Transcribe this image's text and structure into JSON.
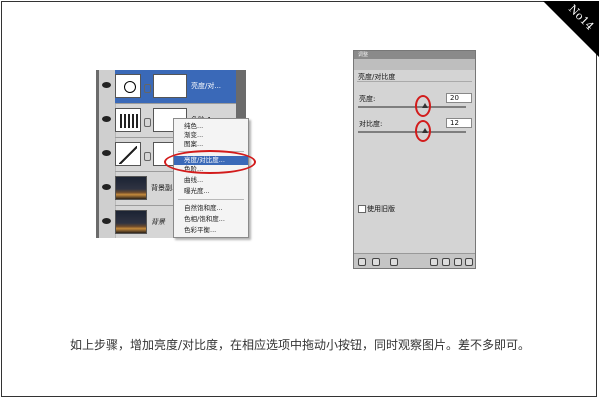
{
  "badge": "No14",
  "layers_panel": {
    "layers": [
      {
        "name": "亮度/对...",
        "thumb_icon": "brightness-adjustment-icon",
        "selected": true
      },
      {
        "name": "色阶 1",
        "thumb_icon": "levels-adjustment-icon",
        "selected": false
      },
      {
        "name": "",
        "thumb_icon": "curves-adjustment-icon",
        "selected": false
      },
      {
        "name": "背景副...",
        "thumb_icon": "photo-thumbnail",
        "selected": false
      },
      {
        "name": "背景",
        "thumb_icon": "photo-thumbnail",
        "selected": false
      }
    ]
  },
  "context_menu": {
    "items": [
      {
        "label": "纯色...",
        "highlight": false
      },
      {
        "label": "渐变...",
        "highlight": false
      },
      {
        "label": "图案...",
        "highlight": false
      },
      {
        "label": "亮度/对比度...",
        "highlight": true
      },
      {
        "label": "色阶...",
        "highlight": false
      },
      {
        "label": "曲线...",
        "highlight": false
      },
      {
        "label": "曝光度...",
        "highlight": false
      },
      {
        "label": "自然饱和度...",
        "highlight": false
      },
      {
        "label": "色相/饱和度...",
        "highlight": false
      },
      {
        "label": "色彩平衡...",
        "highlight": false
      }
    ]
  },
  "adjustments_panel": {
    "tab_label": "调整",
    "title": "亮度/对比度",
    "brightness": {
      "label": "亮度:",
      "value": "20"
    },
    "contrast": {
      "label": "对比度:",
      "value": "12"
    },
    "legacy_checkbox": {
      "label": "使用旧版",
      "checked": false
    },
    "footer_icons": [
      "back-icon",
      "expand-icon",
      "clip-icon",
      "visibility-icon",
      "view-previous-icon",
      "reset-icon",
      "delete-icon"
    ]
  },
  "highlight_color": "#d21b1b",
  "caption": "如上步骤，增加亮度/对比度，在相应选项中拖动小按钮，同时观察图片。差不多即可。"
}
